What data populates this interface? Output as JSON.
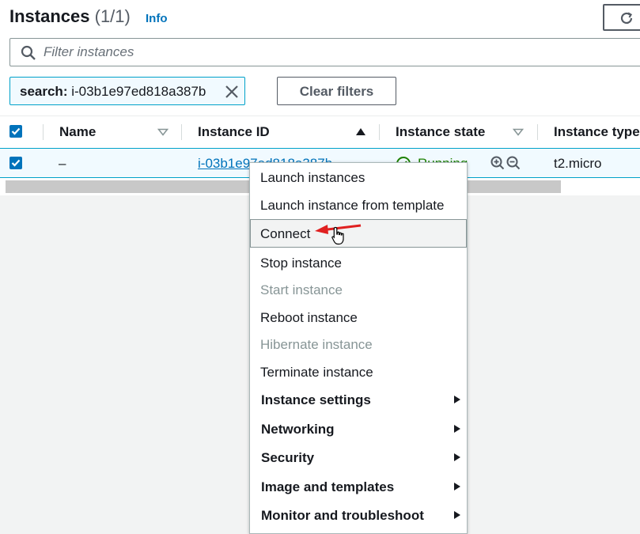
{
  "header": {
    "title": "Instances",
    "count": "(1/1)",
    "info_label": "Info"
  },
  "filter": {
    "placeholder": "Filter instances"
  },
  "token": {
    "key": "search:",
    "value": "i-03b1e97ed818a387b"
  },
  "clear_filters_label": "Clear filters",
  "table": {
    "columns": [
      "Name",
      "Instance ID",
      "Instance state",
      "Instance type"
    ],
    "rows": [
      {
        "name": "–",
        "instance_id": "i-03b1e97ed818a387b",
        "state": "Running",
        "type": "t2.micro"
      }
    ]
  },
  "context_menu": {
    "items": [
      {
        "label": "Launch instances"
      },
      {
        "label": "Launch instance from template"
      },
      {
        "label": "Connect"
      },
      {
        "label": "Stop instance"
      },
      {
        "label": "Start instance"
      },
      {
        "label": "Reboot instance"
      },
      {
        "label": "Hibernate instance"
      },
      {
        "label": "Terminate instance"
      },
      {
        "label": "Instance settings"
      },
      {
        "label": "Networking"
      },
      {
        "label": "Security"
      },
      {
        "label": "Image and templates"
      },
      {
        "label": "Monitor and troubleshoot"
      }
    ]
  },
  "colors": {
    "link": "#0073bb",
    "running": "#1d8102",
    "selected_row": "#f1faff",
    "annotation_arrow": "#e02020"
  }
}
